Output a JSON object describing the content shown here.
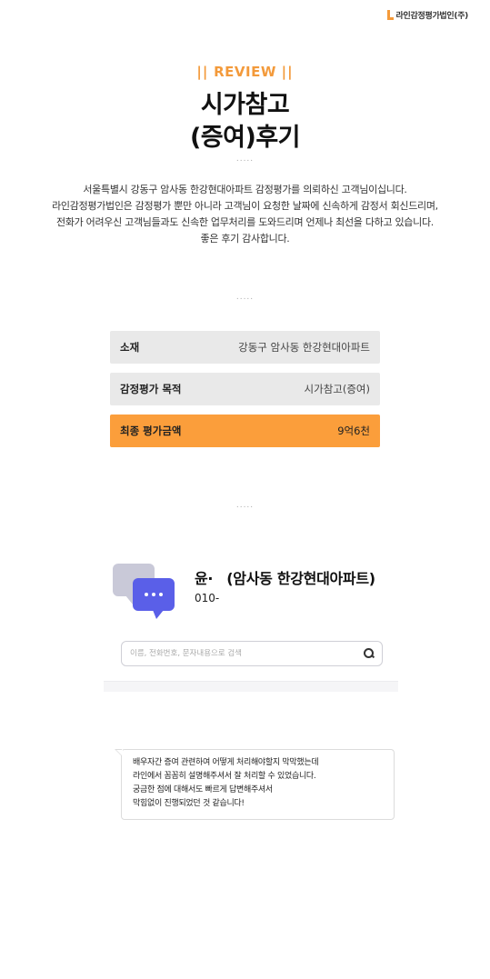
{
  "brand": {
    "name": "라인감정평가법인(주)"
  },
  "header": {
    "tag": "REVIEW",
    "tag_bars": "||",
    "title_line1": "시가참고",
    "title_line2": "(증여)후기",
    "separator": "....."
  },
  "description": [
    "서울특별시 강동구 암사동 한강현대아파트 감정평가를 의뢰하신 고객님이십니다.",
    "라인감정평가법인은 감정평가 뿐만 아니라 고객님이 요청한 날짜에 신속하게 감정서 회신드리며,",
    "전화가 어려우신 고객님들과도 신속한 업무처리를 도와드리며 언제나 최선을 다하고 있습니다.",
    "좋은 후기 감사합니다."
  ],
  "info": {
    "rows": [
      {
        "label": "소재",
        "value": "강동구 암사동 한강현대아파트"
      },
      {
        "label": "감정평가 목적",
        "value": "시가참고(증여)"
      },
      {
        "label": "최종 평가금액",
        "value": "9억6천"
      }
    ],
    "highlight_color": "#fb9e3b"
  },
  "contact": {
    "name": "윤·",
    "place": "(암사동 한강현대아파트)",
    "phone": "010-"
  },
  "search": {
    "placeholder": "이름, 전화번호, 문자내용으로 검색",
    "icon": "search-icon"
  },
  "message": {
    "lines": [
      "배우자간 증여 관련하여 어떻게 처리해야할지 막막했는데",
      "라인에서 꼼꼼히 설명해주셔서 잘 처리할 수 있었습니다.",
      "궁금한 점에 대해서도 빠르게 답변해주셔서",
      "막힘없이 진행되었던 것 같습니다!"
    ]
  },
  "colors": {
    "accent": "#f39a3b",
    "chat_icon": "#5a5fe8"
  }
}
